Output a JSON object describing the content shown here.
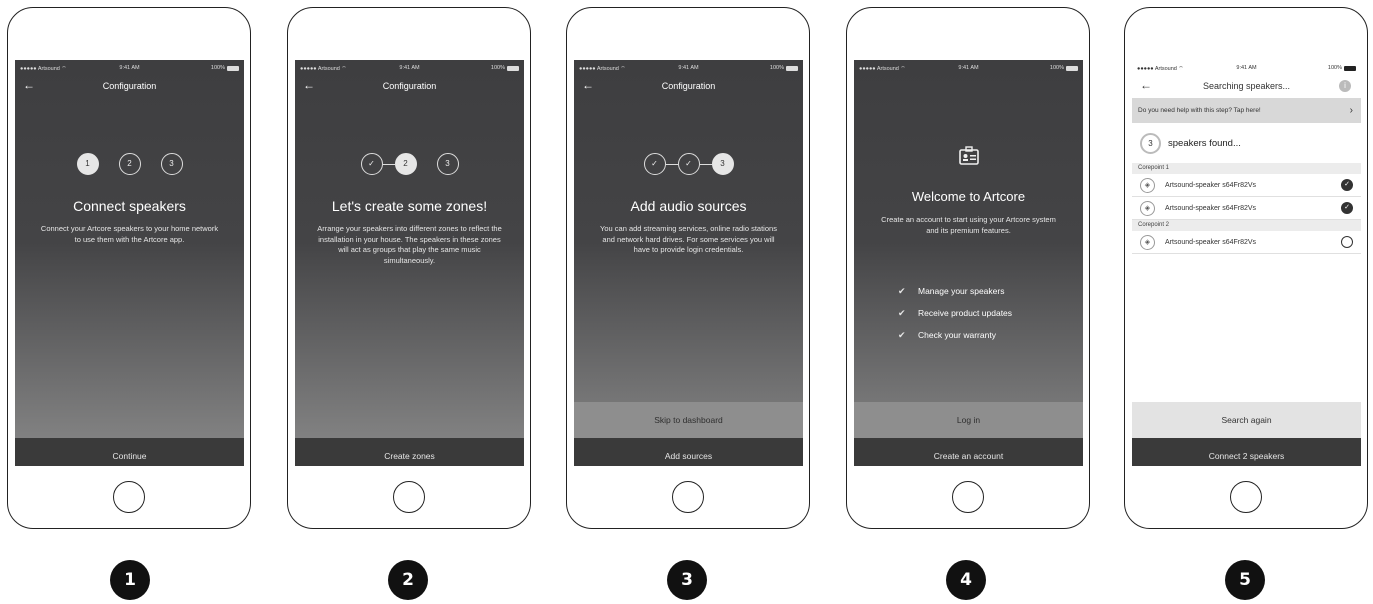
{
  "status": {
    "carrier": "●●●●● Artsound",
    "wifi": "⌔",
    "time": "9:41 AM",
    "battery": "100%"
  },
  "screens": {
    "s1": {
      "nav_title": "Configuration",
      "steps": [
        "1",
        "2",
        "3"
      ],
      "headline": "Connect speakers",
      "desc": "Connect your Artcore speakers to your home network to use them with the Artcore app.",
      "primary_button": "Continue"
    },
    "s2": {
      "nav_title": "Configuration",
      "steps": [
        "✓",
        "2",
        "3"
      ],
      "headline": "Let's create some zones!",
      "desc": "Arrange your speakers into different zones to reflect the installation in your house. The speakers in these zones will act as groups that play the same music simultaneously.",
      "primary_button": "Create zones"
    },
    "s3": {
      "nav_title": "Configuration",
      "steps": [
        "✓",
        "✓",
        "3"
      ],
      "headline": "Add audio sources",
      "desc": "You can add streaming services, online radio stations and network hard drives. For some services you will have to provide login credentials.",
      "secondary_button": "Skip to dashboard",
      "primary_button": "Add sources"
    },
    "s4": {
      "headline": "Welcome to Artcore",
      "desc": "Create an account to start using your Artcore system and its premium features.",
      "benefits": [
        "Manage your speakers",
        "Receive product updates",
        "Check your warranty"
      ],
      "secondary_button": "Log in",
      "primary_button": "Create an account"
    },
    "s5": {
      "nav_title": "Searching speakers...",
      "help_text": "Do you need help with this step? Tap here!",
      "found_count": "3",
      "found_text": "speakers found...",
      "groups": [
        {
          "name": "Corepoint 1",
          "speakers": [
            {
              "name": "Artsound-speaker s64Fr82Vs",
              "selected": true
            },
            {
              "name": "Artsound-speaker s64Fr82Vs",
              "selected": true
            }
          ]
        },
        {
          "name": "Corepoint 2",
          "speakers": [
            {
              "name": "Artsound-speaker s64Fr82Vs",
              "selected": false
            }
          ]
        }
      ],
      "secondary_button": "Search again",
      "primary_button": "Connect 2 speakers"
    }
  },
  "badges": [
    "1",
    "2",
    "3",
    "4",
    "5"
  ],
  "colors": {
    "screen_dark": "#3e3e40",
    "button_dark": "#3a3a3a",
    "button_mid": "#8e8e8e",
    "accent_light": "#e6e6e6"
  }
}
